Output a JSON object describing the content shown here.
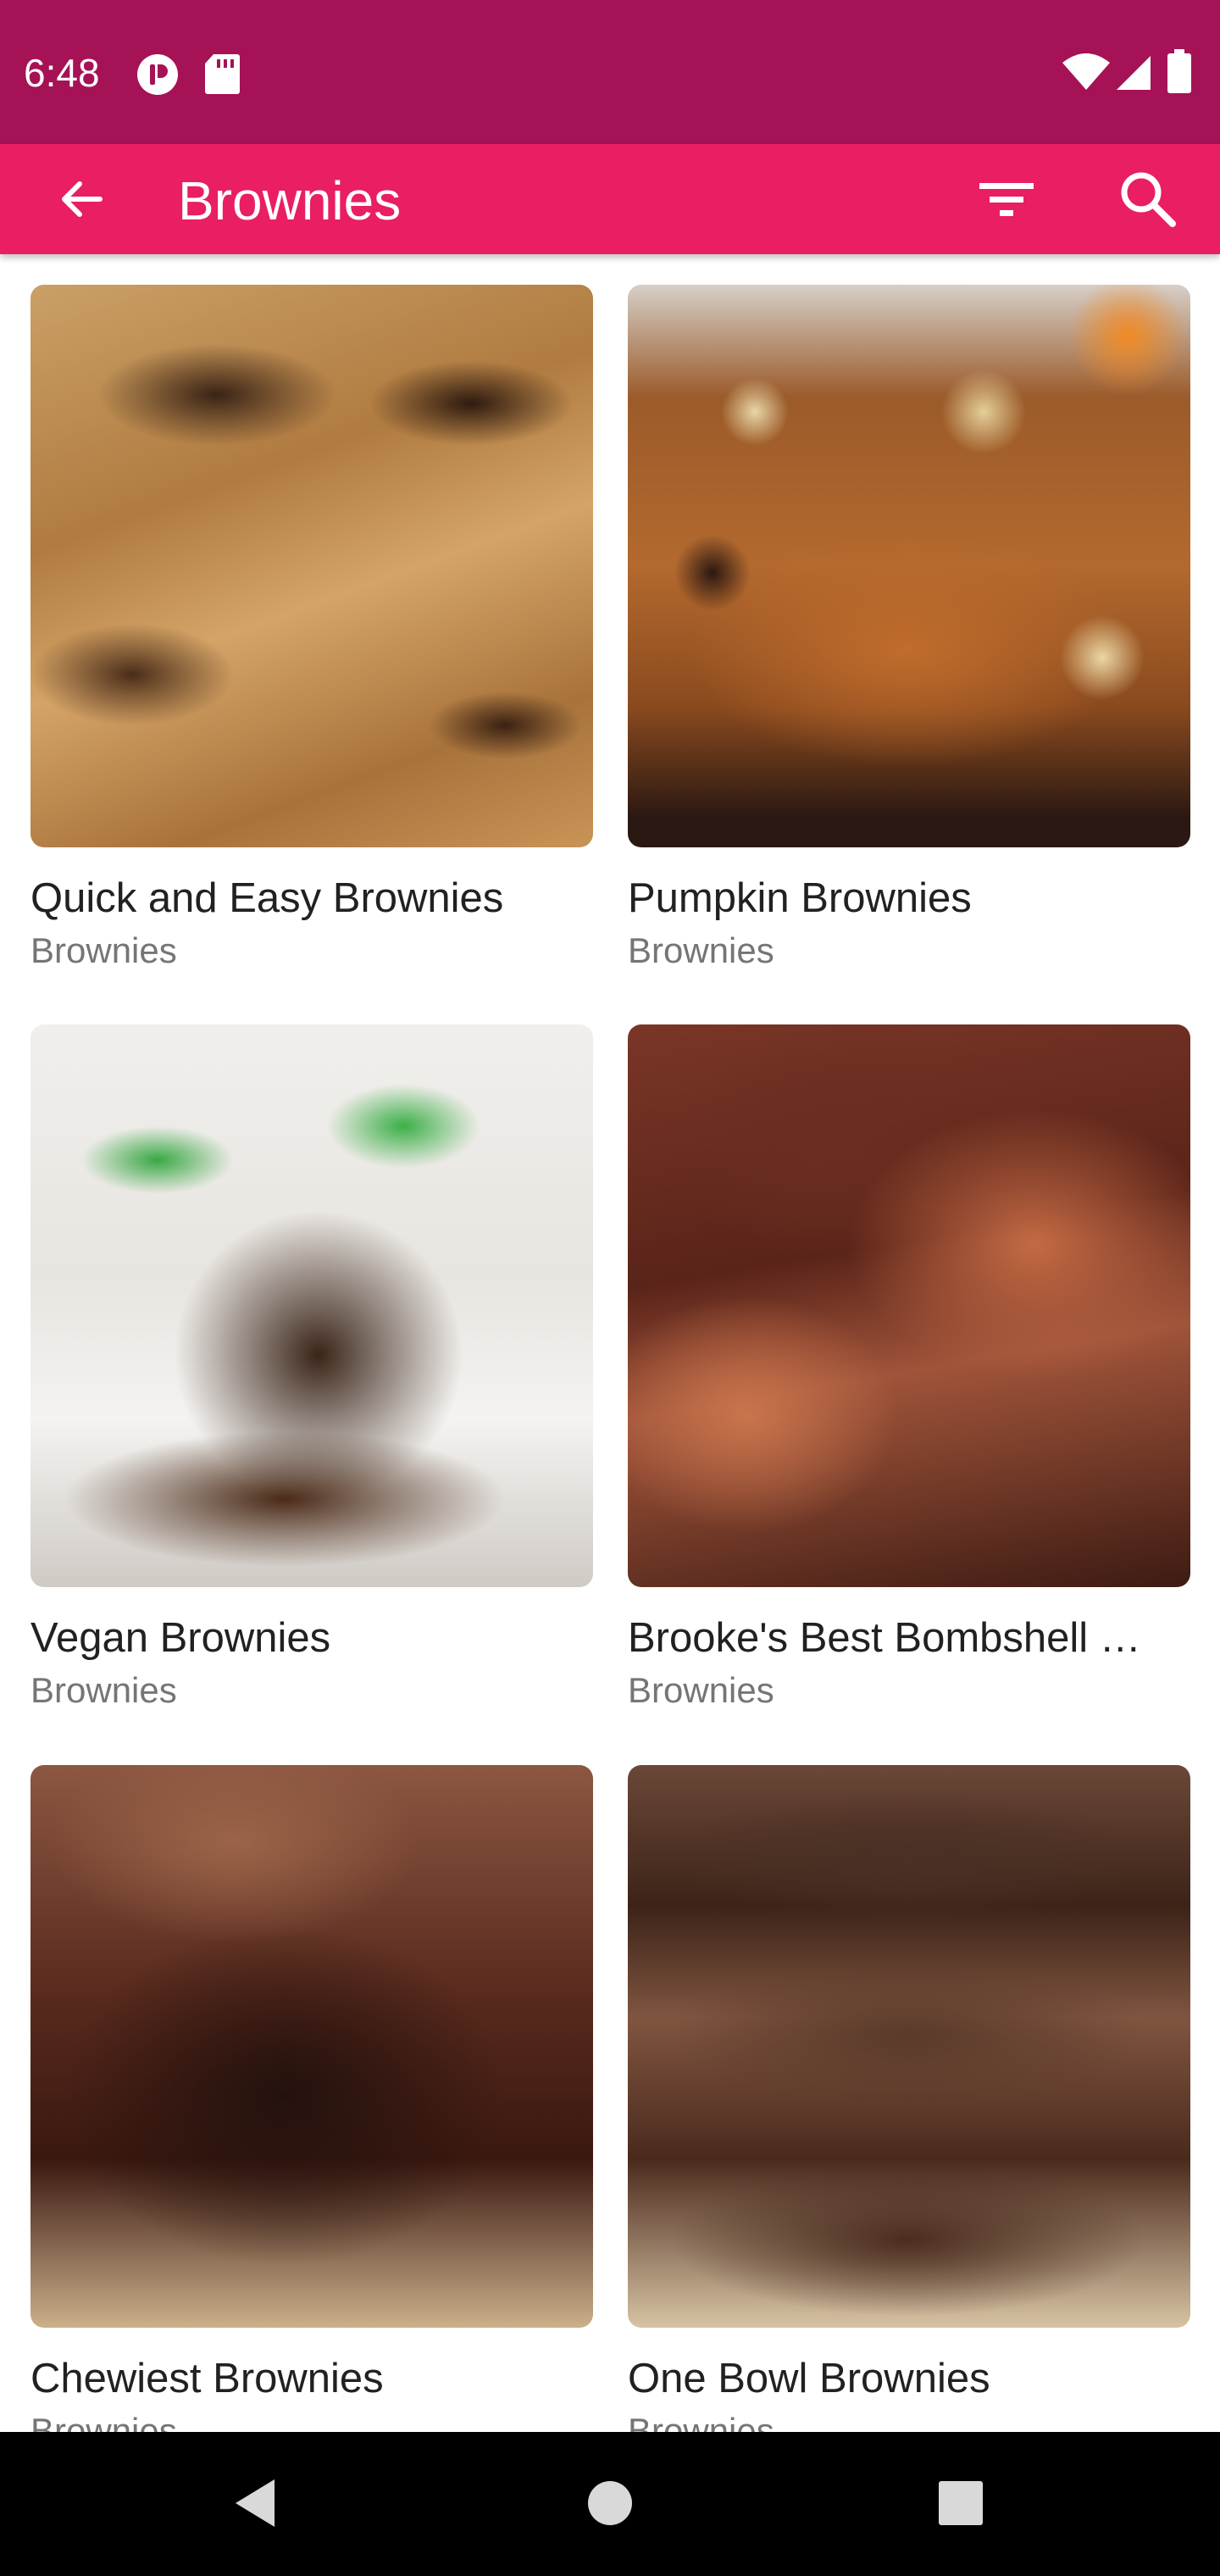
{
  "status_bar": {
    "time": "6:48",
    "icons": [
      "notification-app-icon",
      "sd-card-icon",
      "wifi-icon",
      "signal-icon",
      "battery-icon"
    ]
  },
  "app_bar": {
    "title": "Brownies",
    "icons": [
      "back-arrow-icon",
      "filter-icon",
      "search-icon"
    ]
  },
  "recipes": [
    {
      "title": "Quick and Easy Brownies",
      "category": "Brownies"
    },
    {
      "title": "Pumpkin Brownies",
      "category": "Brownies"
    },
    {
      "title": "Vegan Brownies",
      "category": "Brownies"
    },
    {
      "title": "Brooke's Best Bombshell …",
      "category": "Brownies"
    },
    {
      "title": "Chewiest Brownies",
      "category": "Brownies"
    },
    {
      "title": "One Bowl Brownies",
      "category": "Brownies"
    }
  ],
  "nav_bar": {
    "icons": [
      "back-triangle-icon",
      "home-circle-icon",
      "recents-square-icon"
    ]
  },
  "colors": {
    "status_bar": "#a51255",
    "app_bar": "#e91e63",
    "title_text": "#212121",
    "subtitle_text": "#757575"
  }
}
